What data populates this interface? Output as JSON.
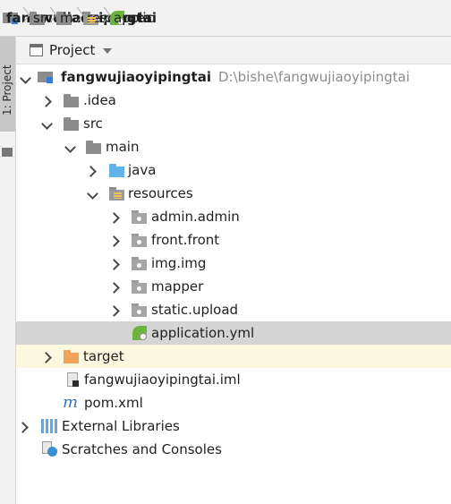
{
  "navbar": {
    "items": [
      {
        "label": "fangwujiaoyipingtai",
        "icon": "module-icon"
      },
      {
        "label": "src",
        "icon": "folder-icon"
      },
      {
        "label": "main",
        "icon": "folder-icon"
      },
      {
        "label": "resources",
        "icon": "resources-folder-icon"
      },
      {
        "label": "applic",
        "icon": "spring-leaf-icon"
      }
    ]
  },
  "tool_strip": {
    "tab_label": "1: Project"
  },
  "project_panel": {
    "title": "Project"
  },
  "tree": {
    "root": {
      "label": "fangwujiaoyipingtai",
      "path": "D:\\bishe\\fangwujiaoyipingtai"
    },
    "idea": {
      "label": ".idea"
    },
    "src": {
      "label": "src"
    },
    "main": {
      "label": "main"
    },
    "java": {
      "label": "java"
    },
    "resources": {
      "label": "resources"
    },
    "admin": {
      "label": "admin.admin"
    },
    "front": {
      "label": "front.front"
    },
    "img": {
      "label": "img.img"
    },
    "mapper": {
      "label": "mapper"
    },
    "static": {
      "label": "static.upload"
    },
    "application": {
      "label": "application.yml"
    },
    "target": {
      "label": "target"
    },
    "iml": {
      "label": "fangwujiaoyipingtai.iml"
    },
    "pom": {
      "label": "pom.xml"
    },
    "libraries": {
      "label": "External Libraries"
    },
    "scratches": {
      "label": "Scratches and Consoles"
    }
  },
  "colors": {
    "folder_gray": "#8c8c8c",
    "folder_blue": "#63b3e8",
    "folder_orange": "#f0a35a",
    "selection": "#d5d5d5",
    "highlight": "#fbf8df"
  }
}
